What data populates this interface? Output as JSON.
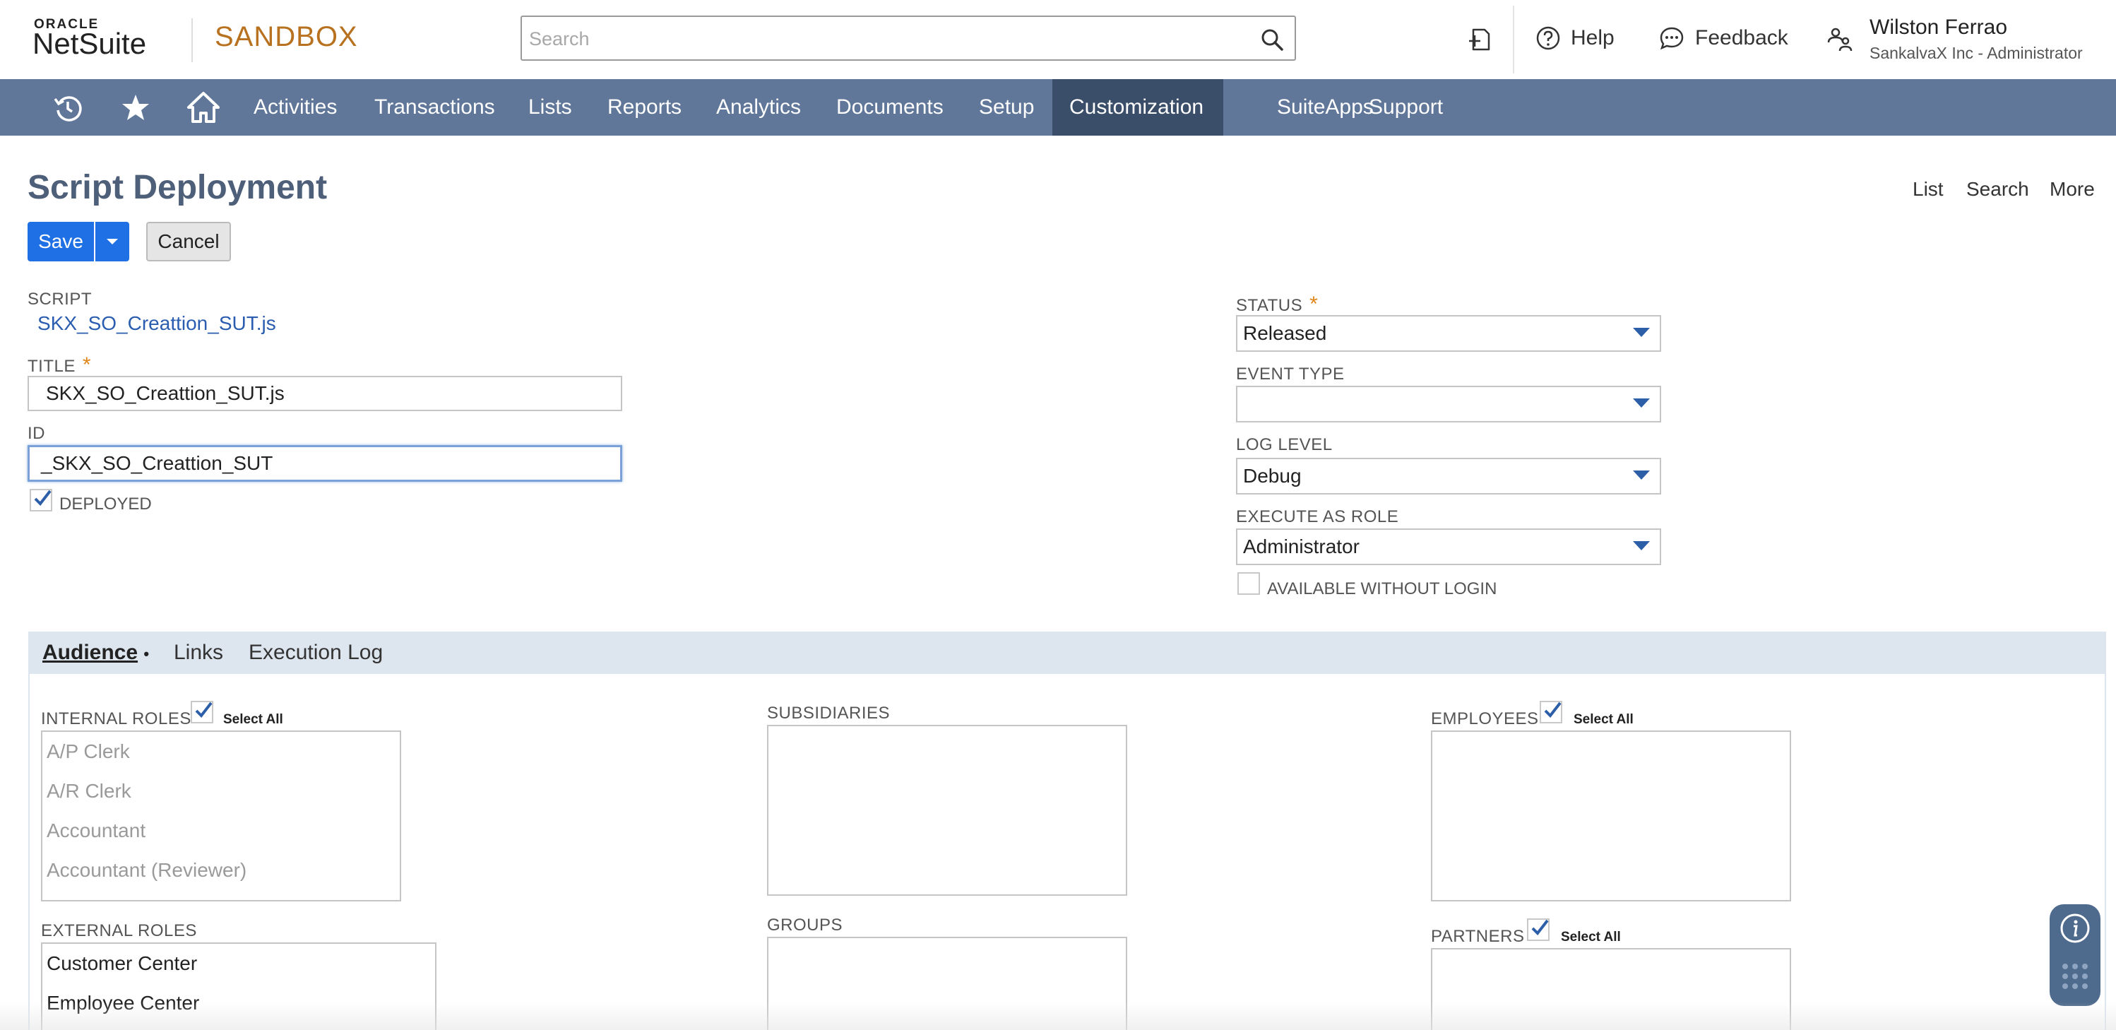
{
  "header": {
    "logo_top": "ORACLE",
    "logo_main": "NetSuite",
    "environment": "SANDBOX",
    "search_placeholder": "Search",
    "help_label": "Help",
    "feedback_label": "Feedback",
    "user_name": "Wilston Ferrao",
    "user_role": "SankalvaX Inc - Administrator"
  },
  "nav": {
    "items": [
      "Activities",
      "Transactions",
      "Lists",
      "Reports",
      "Analytics",
      "Documents",
      "Setup",
      "Customization",
      "SuiteApps",
      "Support"
    ],
    "active": "Customization"
  },
  "page": {
    "title": "Script Deployment",
    "links": {
      "list": "List",
      "search": "Search",
      "more": "More"
    },
    "save_label": "Save",
    "cancel_label": "Cancel"
  },
  "form": {
    "script_label": "SCRIPT",
    "script_value": "SKX_SO_Creattion_SUT.js",
    "title_label": "TITLE",
    "title_value": "SKX_SO_Creattion_SUT.js",
    "id_label": "ID",
    "id_value": "_SKX_SO_Creattion_SUT",
    "deployed_label": "DEPLOYED",
    "deployed_checked": true,
    "status_label": "STATUS",
    "status_value": "Released",
    "event_type_label": "EVENT TYPE",
    "event_type_value": "",
    "log_level_label": "LOG LEVEL",
    "log_level_value": "Debug",
    "execute_as_role_label": "EXECUTE AS ROLE",
    "execute_as_role_value": "Administrator",
    "available_without_login_label": "AVAILABLE WITHOUT LOGIN",
    "available_without_login_checked": false
  },
  "tabs": {
    "audience": "Audience",
    "audience_marker": "•",
    "links": "Links",
    "execution_log": "Execution Log",
    "active": "Audience"
  },
  "audience": {
    "internal_roles_label": "INTERNAL ROLES",
    "select_all_label": "Select All",
    "internal_roles": [
      "A/P Clerk",
      "A/R Clerk",
      "Accountant",
      "Accountant (Reviewer)"
    ],
    "external_roles_label": "EXTERNAL ROLES",
    "external_roles": [
      "Customer Center",
      "Employee Center"
    ],
    "subsidiaries_label": "SUBSIDIARIES",
    "groups_label": "GROUPS",
    "employees_label": "EMPLOYEES",
    "partners_label": "PARTNERS"
  },
  "colors": {
    "nav_bg": "#607799",
    "nav_active": "#3b4e69",
    "primary_button": "#1f6fe5",
    "sandbox": "#b7711f",
    "required_star": "#e0871c",
    "link": "#2a5db0",
    "title": "#4d5f79"
  },
  "icons": [
    "search-icon",
    "new-record-icon",
    "help-icon",
    "feedback-icon",
    "user-switch-icon",
    "recent-icon",
    "star-icon",
    "home-icon",
    "dropdown-caret-icon",
    "checkmark-icon",
    "info-icon",
    "grid-dots-icon"
  ]
}
